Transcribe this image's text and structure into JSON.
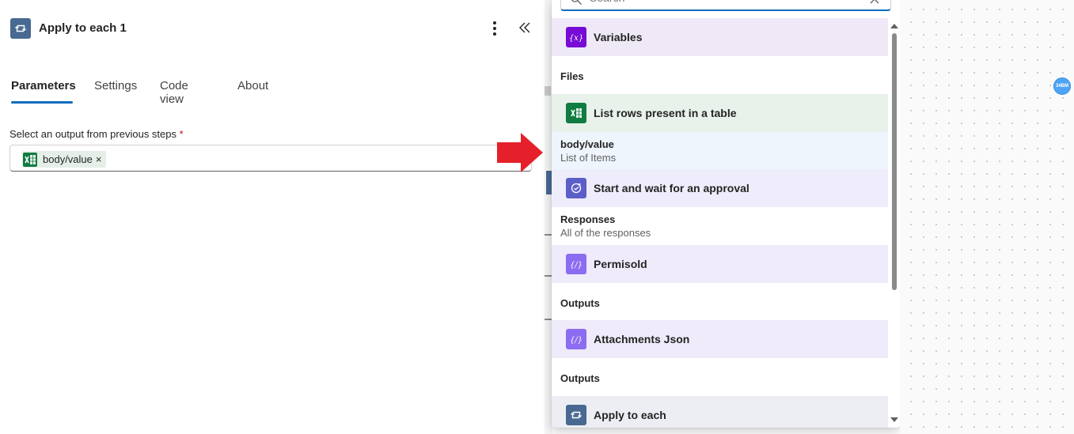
{
  "panel": {
    "title": "Apply to each 1",
    "tabs": [
      "Parameters",
      "Settings",
      "Code view",
      "About"
    ],
    "active_tab": "Parameters",
    "field_label": "Select an output from previous steps",
    "required_marker": "*",
    "token": {
      "label": "body/value",
      "remove": "×"
    }
  },
  "dropdown": {
    "search_placeholder": "Search",
    "items": [
      {
        "kind": "action",
        "label": "Variables",
        "icon": "variables-icon",
        "bg": "#efe9f7",
        "icon_bg": "#770bd6"
      },
      {
        "kind": "section",
        "label": "Files"
      },
      {
        "kind": "action",
        "label": "List rows present in a table",
        "icon": "excel-icon",
        "bg": "#e8f1ea",
        "icon_bg": "#107c41"
      },
      {
        "kind": "output",
        "name": "body/value",
        "desc": "List of Items",
        "bg": "#eef5fd"
      },
      {
        "kind": "action",
        "label": "Start and wait for an approval",
        "icon": "approvals-icon",
        "bg": "#efedfb",
        "icon_bg": "#5b5fc7"
      },
      {
        "kind": "output",
        "name": "Responses",
        "desc": "All of the responses",
        "bg": "#ffffff"
      },
      {
        "kind": "action",
        "label": "Permisold",
        "icon": "compose-icon",
        "bg": "#efebfb",
        "icon_bg": "#8c6cf0"
      },
      {
        "kind": "section",
        "label": "Outputs"
      },
      {
        "kind": "action",
        "label": "Attachments Json",
        "icon": "compose-icon",
        "bg": "#efebfb",
        "icon_bg": "#8c6cf0"
      },
      {
        "kind": "section",
        "label": "Outputs"
      },
      {
        "kind": "action",
        "label": "Apply to each",
        "icon": "loop-icon",
        "bg": "#eceef3",
        "icon_bg": "#486991"
      }
    ]
  },
  "avatar": {
    "initials": "34BM"
  },
  "colors": {
    "accent": "#0f6cbd",
    "pointer_arrow": "#e5202a"
  }
}
